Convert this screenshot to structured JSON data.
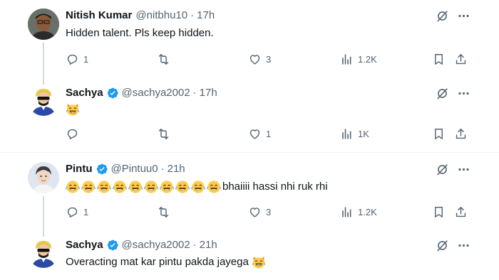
{
  "tweets": [
    {
      "name": "Nitish Kumar",
      "verified": false,
      "handle": "@nitbhu10",
      "time": "17h",
      "text": "Hidden talent. Pls keep hidden.",
      "emoji_count": 0,
      "actions": {
        "replies": "1",
        "reposts": "",
        "likes": "3",
        "views": "1.2K"
      }
    },
    {
      "name": "Sachya",
      "verified": true,
      "handle": "@sachya2002",
      "time": "17h",
      "text": "",
      "emoji": "😹",
      "actions": {
        "replies": "",
        "reposts": "",
        "likes": "1",
        "views": "1K"
      }
    },
    {
      "name": "Pintu",
      "verified": true,
      "handle": "@Pintuu0",
      "time": "21h",
      "text": "bhaiiii hassi nhi ruk rhi",
      "emoji": "😂",
      "emoji_count": 10,
      "actions": {
        "replies": "1",
        "reposts": "",
        "likes": "3",
        "views": "1.2K"
      }
    },
    {
      "name": "Sachya",
      "verified": true,
      "handle": "@sachya2002",
      "time": "21h",
      "text": "Overacting mat kar pintu pakda jayega",
      "emoji": "😹"
    }
  ],
  "separator": "·",
  "icons": {
    "grok": "grok-icon",
    "more": "more-icon",
    "reply": "reply-icon",
    "repost": "repost-icon",
    "like": "like-icon",
    "views": "views-icon",
    "bookmark": "bookmark-icon",
    "share": "share-icon"
  },
  "colors": {
    "verified": "#1d9bf0",
    "secondary_text": "#536471",
    "primary_text": "#0f1419"
  }
}
